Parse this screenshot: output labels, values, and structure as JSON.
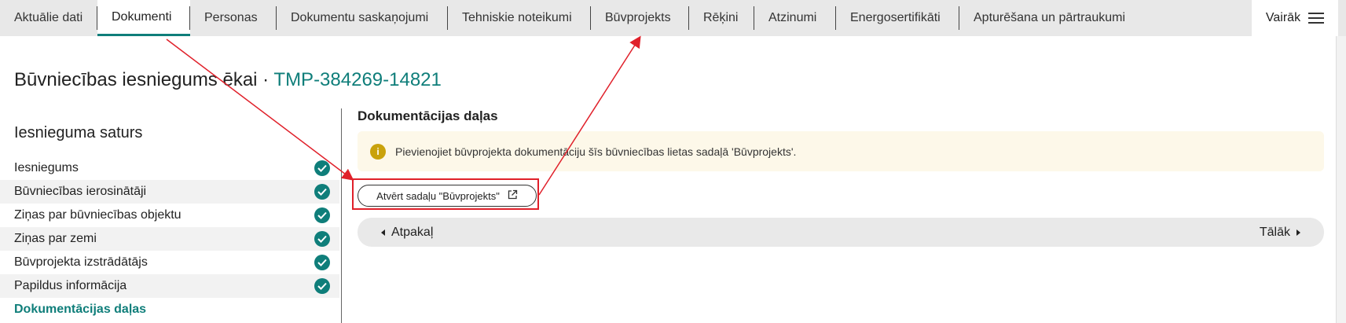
{
  "tabs": [
    {
      "label": "Aktuālie dati"
    },
    {
      "label": "Dokumenti"
    },
    {
      "label": "Personas"
    },
    {
      "label": "Dokumentu saskaņojumi"
    },
    {
      "label": "Tehniskie noteikumi"
    },
    {
      "label": "Būvprojekts"
    },
    {
      "label": "Rēķini"
    },
    {
      "label": "Atzinumi"
    },
    {
      "label": "Energosertifikāti"
    },
    {
      "label": "Apturēšana un pārtraukumi"
    }
  ],
  "active_tab": "Dokumenti",
  "more_label": "Vairāk",
  "page": {
    "title": "Būvniecības iesniegums ēkai · ",
    "id": "TMP-384269-14821"
  },
  "sidebar": {
    "heading": "Iesnieguma saturs",
    "items": [
      {
        "label": "Iesniegums",
        "done": true
      },
      {
        "label": "Būvniecības ierosinātāji",
        "done": true
      },
      {
        "label": "Ziņas par būvniecības objektu",
        "done": true
      },
      {
        "label": "Ziņas par zemi",
        "done": true
      },
      {
        "label": "Būvprojekta izstrādātājs",
        "done": true
      },
      {
        "label": "Papildus informācija",
        "done": true
      },
      {
        "label": "Dokumentācijas daļas",
        "done": false,
        "current": true
      }
    ]
  },
  "main": {
    "section_title": "Dokumentācijas daļas",
    "notice": "Pievienojiet būvprojekta dokumentāciju šīs būvniecības lietas sadaļā 'Būvprojekts'.",
    "open_button": "Atvērt sadaļu \"Būvprojekts\"",
    "back": "Atpakaļ",
    "next": "Tālāk"
  },
  "colors": {
    "accent": "#0f7e7a",
    "annotation": "#e0202a",
    "notice_bg": "#fdf8e9",
    "info": "#c9a20c"
  },
  "icons": [
    "check-icon",
    "info-icon",
    "external-link-icon",
    "hamburger-icon",
    "caret-left-icon",
    "caret-right-icon"
  ]
}
